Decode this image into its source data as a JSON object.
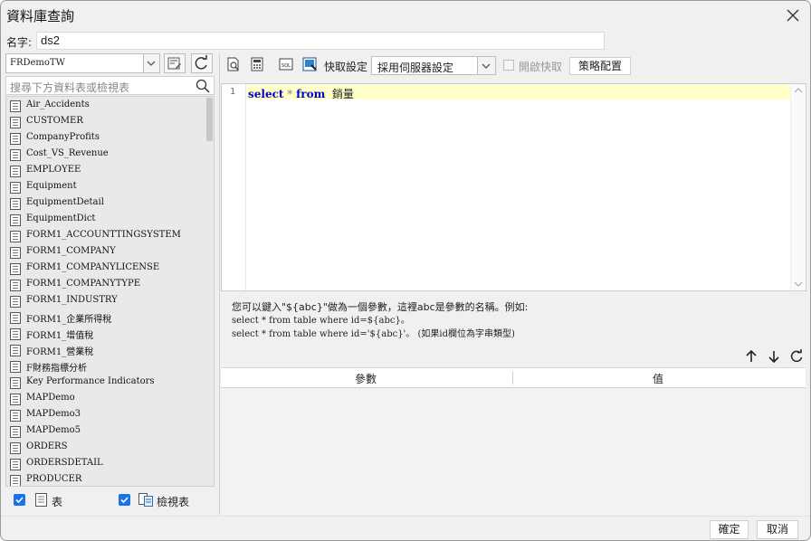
{
  "window": {
    "title": "資料庫查詢"
  },
  "name_field": {
    "label": "名字:",
    "value": "ds2"
  },
  "datasource": {
    "selected": "FRDemoTW"
  },
  "search": {
    "placeholder": "搜尋下方資料表或檢視表"
  },
  "tables": [
    "Air_Accidents",
    "CUSTOMER",
    "CompanyProfits",
    "Cost_VS_Revenue",
    "EMPLOYEE",
    "Equipment",
    "EquipmentDetail",
    "EquipmentDict",
    "FORM1_ACCOUNTTINGSYSTEM",
    "FORM1_COMPANY",
    "FORM1_COMPANYLICENSE",
    "FORM1_COMPANYTYPE",
    "FORM1_INDUSTRY",
    "FORM1_企業所得稅",
    "FORM1_增值稅",
    "FORM1_營業稅",
    "F財務指標分析",
    "Key Performance Indicators",
    "MAPDemo",
    "MAPDemo3",
    "MAPDemo5",
    "ORDERS",
    "ORDERSDETAIL",
    "PRODUCER"
  ],
  "filters": {
    "tables_label": "表",
    "views_label": "檢視表"
  },
  "toolbar": {
    "cache_label": "快取設定",
    "cache_selected": "採用伺服器設定",
    "open_cache_label": "開啟快取",
    "strategy_label": "策略配置"
  },
  "editor": {
    "line_number": "1",
    "kw_select": "select",
    "star": " * ",
    "kw_from": "from",
    "table": "  銷量"
  },
  "help": {
    "line1": "您可以鍵入\"${abc}\"做為一個參數，這裡abc是參數的名稱。例如:",
    "line2": "select * from table where id=${abc}。",
    "line3": "select * from table where id='${abc}'。 (如果id欄位為字串類型)"
  },
  "params": {
    "col_param": "參數",
    "col_value": "值"
  },
  "buttons": {
    "ok": "確定",
    "cancel": "取消"
  }
}
